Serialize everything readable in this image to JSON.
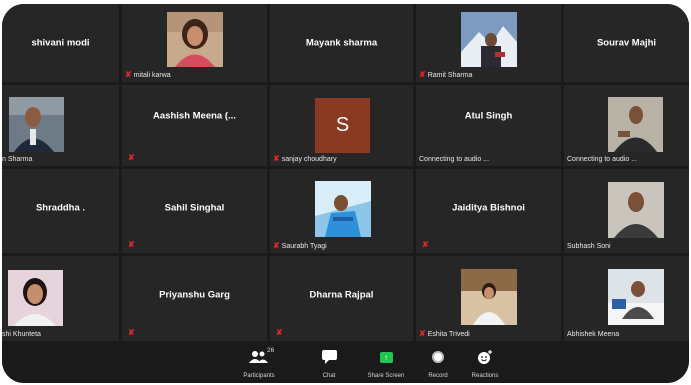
{
  "participants": {
    "tiles": [
      {
        "name": "shivani modi"
      },
      {
        "name": "mitali karwa"
      },
      {
        "name": "Mayank sharma"
      },
      {
        "name": "Ramit Sharma"
      },
      {
        "name": "Sourav Majhi"
      },
      {
        "name": "n Sharma"
      },
      {
        "name": "Aashish Meena (..."
      },
      {
        "name": "sanjay choudhary",
        "avatar_letter": "S"
      },
      {
        "name": "Atul Singh"
      },
      {
        "name": "Connecting to audio ..."
      },
      {
        "status": "Connecting to audio ..."
      },
      {
        "name": "Shraddha ."
      },
      {
        "name": "Sahil Singhal"
      },
      {
        "name": "Saurabh Tyagi"
      },
      {
        "name": "Jaiditya Bishnoi"
      },
      {
        "name": "Subhash Soni"
      },
      {
        "name": "shi Khunteta"
      },
      {
        "name": "Priyanshu Garg"
      },
      {
        "name": "Dharna Rajpal"
      },
      {
        "name": "Eshita Trivedi"
      },
      {
        "name": "Abhishek Meena"
      }
    ]
  },
  "toolbar": {
    "participants_label": "Participants",
    "participants_count": "26",
    "chat_label": "Chat",
    "share_label": "Share Screen",
    "record_label": "Record",
    "reactions_label": "Reactions"
  },
  "colors": {
    "tile_bg": "#262626",
    "muted_mic": "#e02828",
    "share_green": "#23c552",
    "avatar_brown": "#8a3a22"
  }
}
